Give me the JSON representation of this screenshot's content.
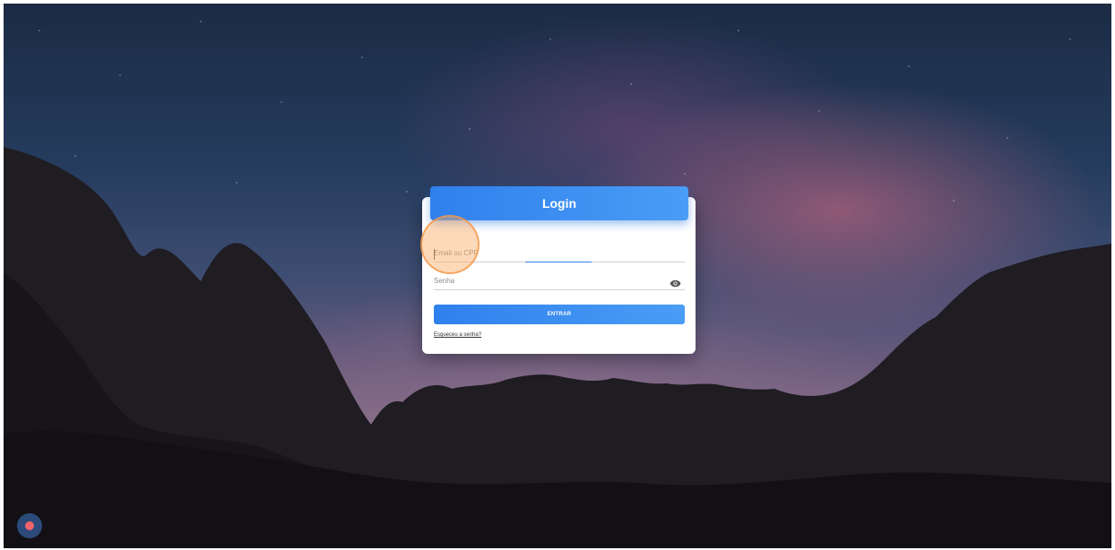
{
  "login_card": {
    "title": "Login",
    "email_placeholder": "Email ou CPF",
    "password_placeholder": "Senha",
    "submit_label": "ENTRAR",
    "forgot_link": "Esqueceu a senha?"
  },
  "icons": {
    "password_toggle": "eye-icon",
    "record": "record-icon"
  },
  "colors": {
    "accent": "#2f80ed",
    "accent_light": "#4a9df5",
    "card_bg": "#ffffff",
    "record_dot": "#f0636d"
  }
}
